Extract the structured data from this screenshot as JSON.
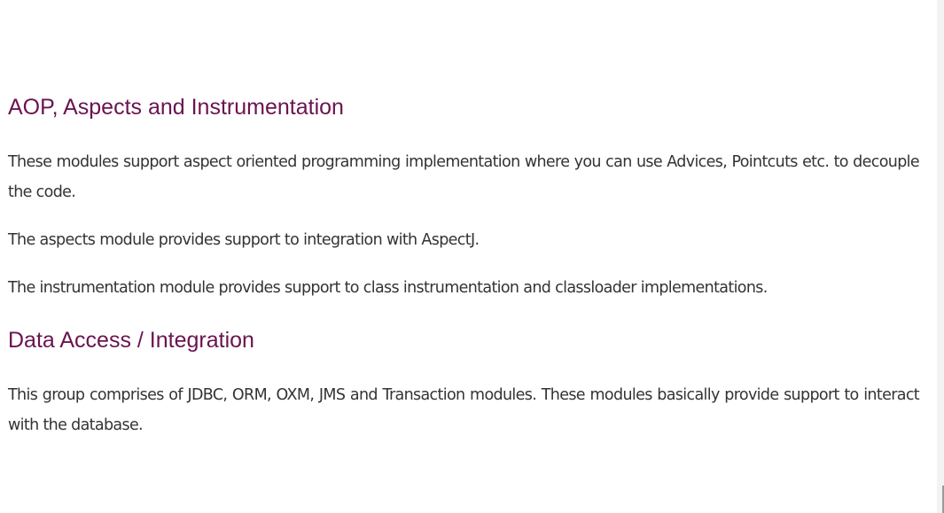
{
  "colors": {
    "heading": "#6a1450",
    "text": "#333333",
    "background": "#ffffff"
  },
  "sections": [
    {
      "title": "AOP, Aspects and Instrumentation",
      "paragraphs": [
        "These modules support aspect oriented programming implementation where you can use Advices, Pointcuts etc. to decouple the code.",
        "The aspects module provides support to integration with AspectJ.",
        "The instrumentation module provides support to class instrumentation and classloader implementations."
      ]
    },
    {
      "title": "Data Access / Integration",
      "paragraphs": [
        "This group comprises of JDBC, ORM, OXM, JMS and Transaction modules. These modules basically provide support to interact with the database."
      ]
    }
  ]
}
